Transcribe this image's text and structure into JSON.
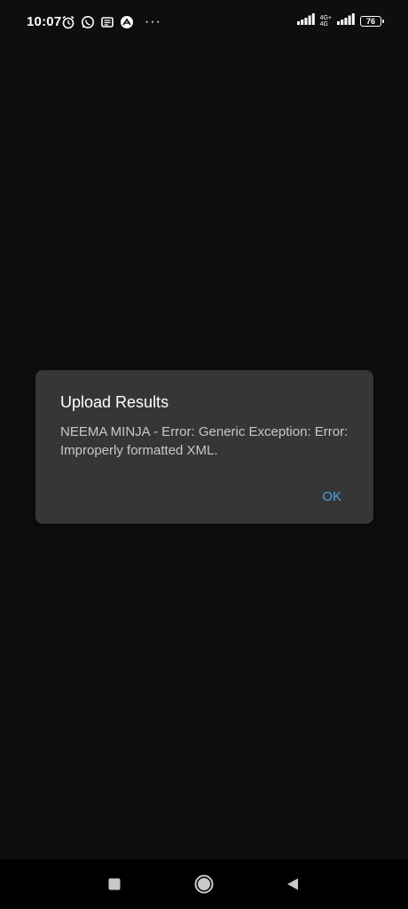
{
  "status_bar": {
    "time": "10:07",
    "network_label_top": "4G+",
    "network_label_bottom": "4G",
    "battery_level": "76",
    "icons_left": [
      "alarm-icon",
      "whatsapp-icon",
      "news-icon",
      "app-icon"
    ],
    "more": "···"
  },
  "dialog": {
    "title": "Upload Results",
    "message": "NEEMA MINJA - Error: Generic Exception: Error: Improperly formatted XML.",
    "ok_label": "OK"
  },
  "colors": {
    "background": "#0e0e0e",
    "dialog_bg": "#363636",
    "accent": "#4aa3df",
    "message_text": "#c8c8c8"
  },
  "nav_bar": {
    "icons": [
      "recent-apps-icon",
      "home-icon",
      "back-icon"
    ]
  }
}
